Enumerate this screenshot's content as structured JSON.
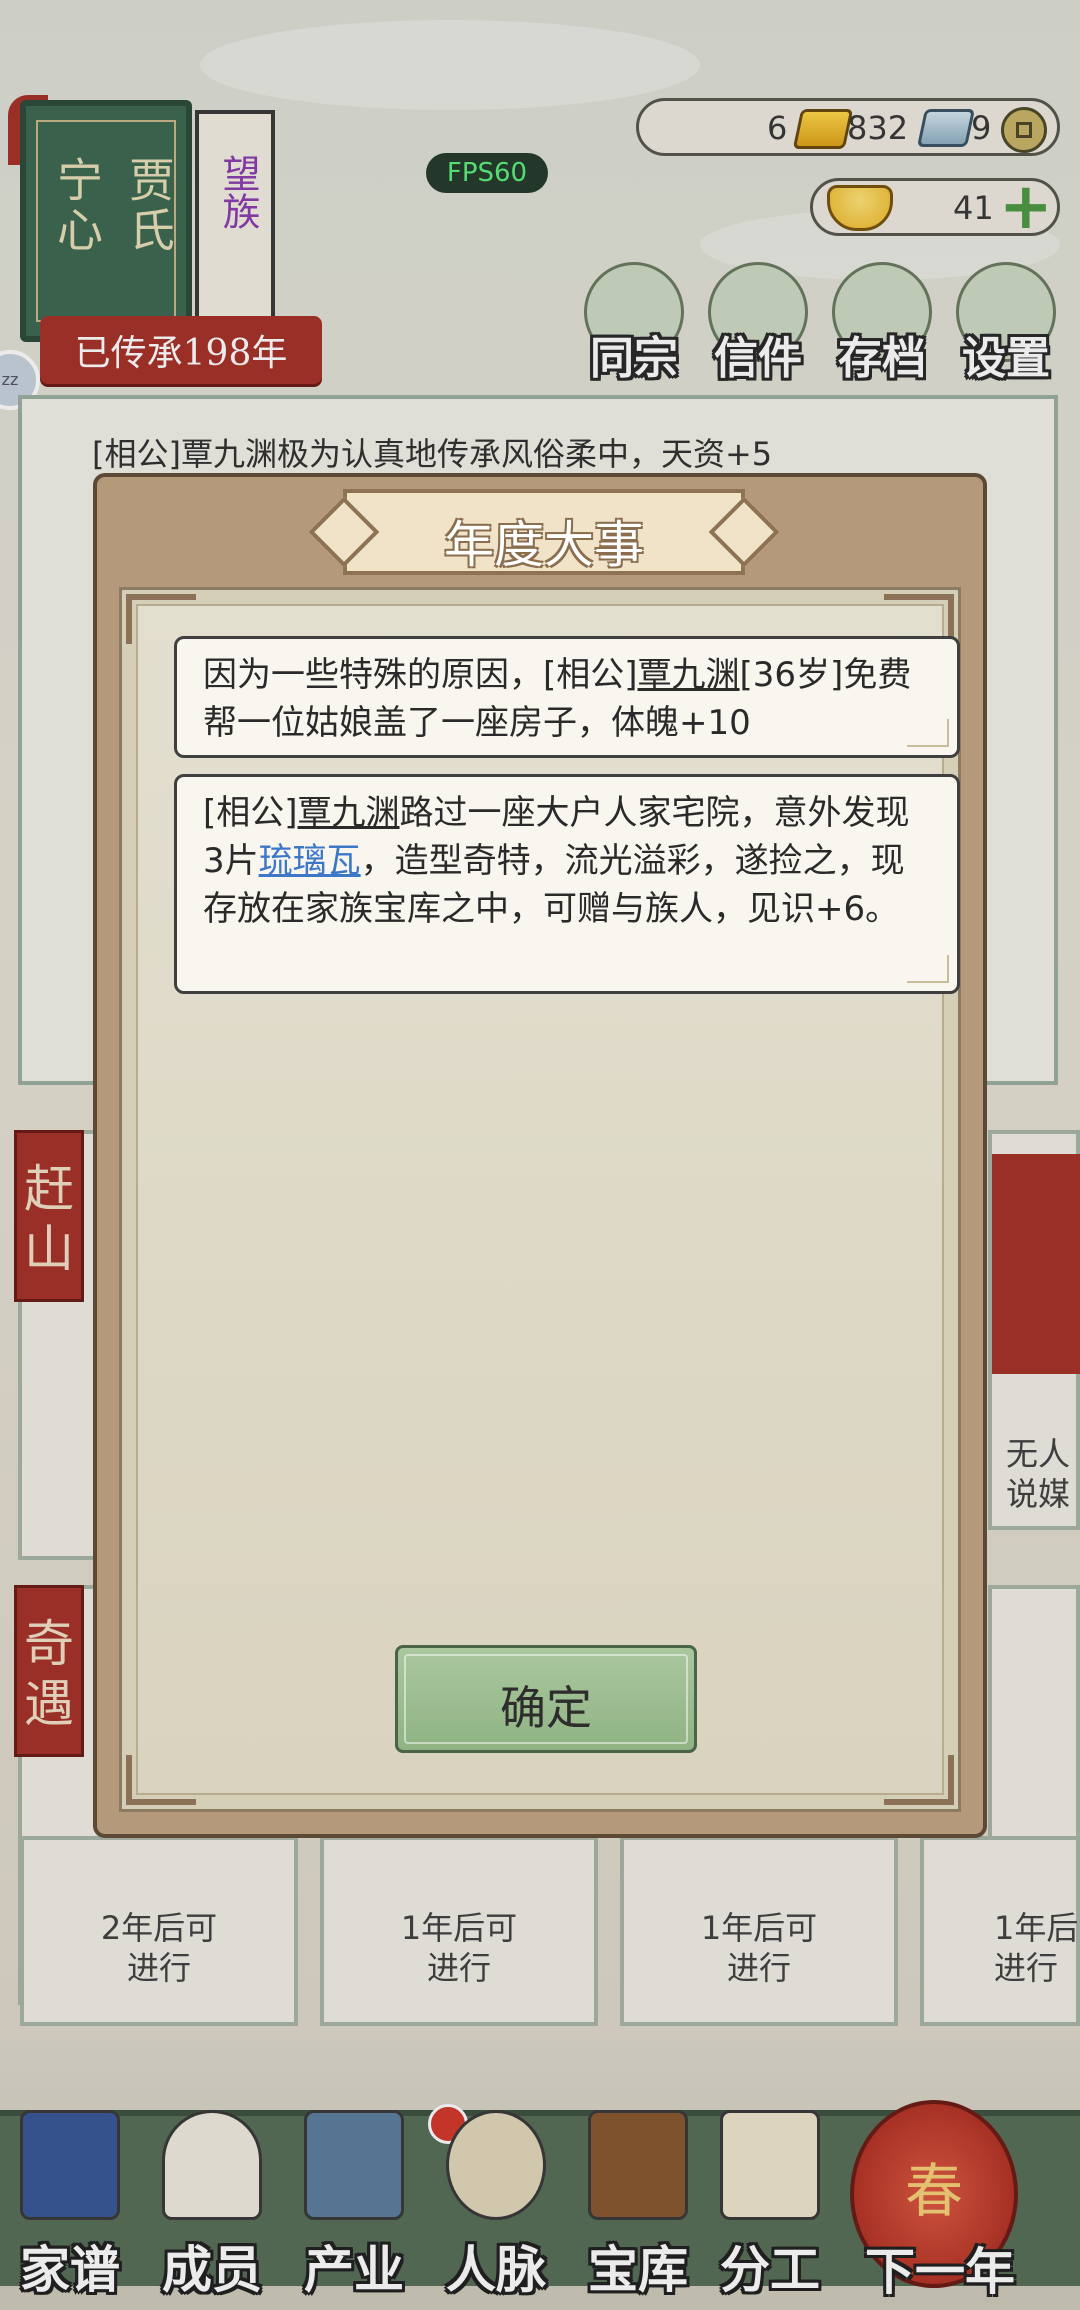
{
  "family": {
    "name_left": "宁心",
    "name_right": "贾氏",
    "rank_tag": "望族",
    "generations": "已传承198年"
  },
  "fps": "FPS60",
  "resources": {
    "gold_count": "6",
    "silver_count": "832",
    "coin_count": "9",
    "yuanbao_count": "41"
  },
  "top_menu": [
    {
      "label": "同宗",
      "icon": "clan-book-icon"
    },
    {
      "label": "信件",
      "icon": "letter-icon"
    },
    {
      "label": "存档",
      "icon": "save-scroll-icon"
    },
    {
      "label": "设置",
      "icon": "gear-icon"
    }
  ],
  "background_log": {
    "line": "[相公]覃九渊极为认真地传承风俗柔中，天资+5"
  },
  "side_sections": {
    "left_top_tag": "赶山",
    "left_bottom_tag": "奇遇",
    "right_card_text": "无人\n说媒"
  },
  "activity_cards": [
    {
      "text": "2年后可\n进行"
    },
    {
      "text": "1年后可\n进行"
    },
    {
      "text": "1年后可\n进行"
    },
    {
      "text": "1年后\n进行"
    }
  ],
  "bottom_nav": [
    {
      "label": "家谱",
      "icon": "genealogy-book-icon"
    },
    {
      "label": "成员",
      "icon": "member-portrait-icon"
    },
    {
      "label": "产业",
      "icon": "building-icon"
    },
    {
      "label": "人脉",
      "icon": "network-icon"
    },
    {
      "label": "宝库",
      "icon": "treasure-chest-icon"
    },
    {
      "label": "分工",
      "icon": "scroll-icon"
    }
  ],
  "next_year": {
    "label": "下一年",
    "lantern_char": "春"
  },
  "modal": {
    "title": "年度大事",
    "events": [
      {
        "prefix": "因为一些特殊的原因，[相公]",
        "person": "覃九渊",
        "suffix": "[36岁]免费帮一位姑娘盖了一座房子，体魄+10"
      },
      {
        "prefix": "[相公]",
        "person": "覃九渊",
        "middle": "路过一座大户人家宅院，意外发现3片",
        "item": "琉璃瓦",
        "suffix": "，造型奇特，流光溢彩，遂捡之，现存放在家族宝库之中，可赠与族人，见识+6。"
      }
    ],
    "confirm_label": "确定"
  },
  "colors": {
    "modal_frame": "#b49a7b",
    "confirm_button": "#9dbd90",
    "item_link": "#3d78c8",
    "tag_red": "#a8332b",
    "fps_text": "#5df07d"
  }
}
